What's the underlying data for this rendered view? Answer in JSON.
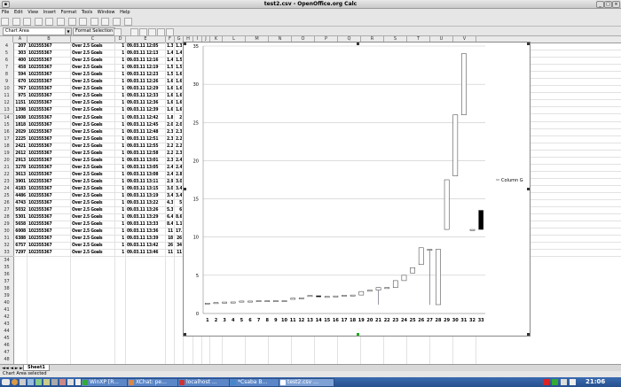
{
  "window": {
    "title": "test2.csv - OpenOffice.org Calc"
  },
  "menu": [
    "File",
    "Edit",
    "View",
    "Insert",
    "Format",
    "Tools",
    "Window",
    "Help"
  ],
  "formatbar": {
    "name_box": "Chart Area",
    "selection_label": "Format Selection"
  },
  "columns": [
    "A",
    "B",
    "C",
    "D",
    "E",
    "F",
    "G",
    "H",
    "I",
    "J",
    "K",
    "L",
    "M",
    "N",
    "O",
    "P",
    "Q",
    "R",
    "S",
    "T",
    "U",
    "V"
  ],
  "rows": [
    [
      "207",
      "102355367",
      "Over 2.5 Goals",
      "1",
      "09.03.11 12:05",
      "1.34",
      "1.36",
      "1.34"
    ],
    [
      "303",
      "102355367",
      "Over 2.5 Goals",
      "1",
      "09.03.11 12:13",
      "1.43",
      "1.43",
      "1.43"
    ],
    [
      "400",
      "102355367",
      "Over 2.5 Goals",
      "1",
      "09.03.11 12:16",
      "1.43",
      "1.5",
      "1.43"
    ],
    [
      "458",
      "102355367",
      "Over 2.5 Goals",
      "1",
      "09.03.11 12:19",
      "1.5",
      "1.5",
      "1.51"
    ],
    [
      "594",
      "102355367",
      "Over 2.5 Goals",
      "1",
      "09.03.11 12:23",
      "1.51",
      "1.63",
      "1.51"
    ],
    [
      "670",
      "102355367",
      "Over 2.5 Goals",
      "1",
      "09.03.11 12:26",
      "1.63",
      "1.63",
      "1.63"
    ],
    [
      "767",
      "102355367",
      "Over 2.5 Goals",
      "1",
      "09.03.11 12:29",
      "1.63",
      "1.68",
      "1.63"
    ],
    [
      "975",
      "102355367",
      "Over 2.5 Goals",
      "1",
      "09.03.11 12:33",
      "1.68",
      "1.68",
      "1.68"
    ],
    [
      "1151",
      "102355367",
      "Over 2.5 Goals",
      "1",
      "09.03.11 12:36",
      "1.68",
      "1.68",
      "1.68"
    ],
    [
      "1398",
      "102355367",
      "Over 2.5 Goals",
      "1",
      "09.03.11 12:39",
      "1.68",
      "1.68",
      "1.68"
    ],
    [
      "1608",
      "102355367",
      "Over 2.5 Goals",
      "1",
      "09.03.11 12:42",
      "1.85",
      "2",
      "1.85"
    ],
    [
      "1818",
      "102355367",
      "Over 2.5 Goals",
      "1",
      "09.03.11 12:45",
      "2.02",
      "2.06",
      "2.02"
    ],
    [
      "2029",
      "102355367",
      "Over 2.5 Goals",
      "1",
      "09.03.11 12:48",
      "2.36",
      "2.36",
      "2.36"
    ],
    [
      "2225",
      "102355367",
      "Over 2.5 Goals",
      "1",
      "09.03.11 12:51",
      "2.32",
      "2.24",
      "2.32"
    ],
    [
      "2421",
      "102355367",
      "Over 2.5 Goals",
      "1",
      "09.03.11 12:55",
      "2.24",
      "2.24",
      "2.24"
    ],
    [
      "2612",
      "102355367",
      "Over 2.5 Goals",
      "1",
      "09.03.11 12:58",
      "2.24",
      "2.3",
      "2.24"
    ],
    [
      "2913",
      "102355367",
      "Over 2.5 Goals",
      "1",
      "09.03.11 13:01",
      "2.3",
      "2.4",
      "2.3"
    ],
    [
      "3278",
      "102355367",
      "Over 2.5 Goals",
      "1",
      "09.03.11 13:05",
      "2.4",
      "2.42",
      "2.4"
    ],
    [
      "3613",
      "102355367",
      "Over 2.5 Goals",
      "1",
      "09.03.11 13:08",
      "2.42",
      "2.88",
      "2.42"
    ],
    [
      "3901",
      "102355367",
      "Over 2.5 Goals",
      "1",
      "09.03.11 13:11",
      "2.92",
      "3.05",
      "1.16"
    ],
    [
      "4183",
      "102355367",
      "Over 2.5 Goals",
      "1",
      "09.03.11 13:15",
      "3.05",
      "3.4",
      "3.05"
    ],
    [
      "4486",
      "102355367",
      "Over 2.5 Goals",
      "1",
      "09.03.11 13:19",
      "3.4",
      "3.4",
      "4.3"
    ],
    [
      "4743",
      "102355367",
      "Over 2.5 Goals",
      "1",
      "09.03.11 13:22",
      "4.3",
      "5",
      "4.3"
    ],
    [
      "5032",
      "102355367",
      "Over 2.5 Goals",
      "1",
      "09.03.11 13:26",
      "5.3",
      "6",
      "5.3"
    ],
    [
      "5301",
      "102355367",
      "Over 2.5 Goals",
      "1",
      "09.03.11 13:29",
      "6.4",
      "8.6",
      "6.4"
    ],
    [
      "5658",
      "102355367",
      "Over 2.5 Goals",
      "1",
      "09.03.11 13:33",
      "8.4",
      "1.13",
      "1.13"
    ],
    [
      "6008",
      "102355367",
      "Over 2.5 Goals",
      "1",
      "09.03.11 13:36",
      "11",
      "17.5",
      "11"
    ],
    [
      "6388",
      "102355367",
      "Over 2.5 Goals",
      "1",
      "09.03.11 13:39",
      "18",
      "26",
      "18"
    ],
    [
      "6757",
      "102355367",
      "Over 2.5 Goals",
      "1",
      "09.03.11 13:42",
      "26",
      "34",
      "26"
    ],
    [
      "7297",
      "102355367",
      "Over 2.5 Goals",
      "1",
      "09.03.11 13:46",
      "11",
      "11",
      "13.5"
    ]
  ],
  "first_row": 4,
  "last_row": 53,
  "chart_data": {
    "type": "candlestick",
    "categories": [
      "1",
      "2",
      "3",
      "4",
      "5",
      "6",
      "7",
      "8",
      "9",
      "10",
      "11",
      "12",
      "13",
      "14",
      "15",
      "16",
      "17",
      "18",
      "19",
      "20",
      "21",
      "22",
      "23",
      "24",
      "25",
      "26",
      "27",
      "28",
      "29",
      "30",
      "31",
      "32",
      "33"
    ],
    "open": [
      1.34,
      1.43,
      1.43,
      1.5,
      1.51,
      1.63,
      1.63,
      1.68,
      1.68,
      1.68,
      1.85,
      2.02,
      2.36,
      2.32,
      2.24,
      2.24,
      2.3,
      2.4,
      2.42,
      2.92,
      3.05,
      3.4,
      3.4,
      4.3,
      5.3,
      6.4,
      8.4,
      1.16,
      11,
      18,
      26,
      11,
      13.5
    ],
    "close": [
      1.36,
      1.43,
      1.5,
      1.51,
      1.63,
      1.63,
      1.68,
      1.68,
      1.68,
      1.68,
      2.0,
      2.06,
      2.36,
      2.24,
      2.24,
      2.3,
      2.4,
      2.42,
      2.88,
      3.05,
      3.4,
      3.4,
      4.3,
      5.0,
      6.0,
      8.6,
      8.4,
      8.4,
      17.5,
      26,
      34,
      11,
      11
    ],
    "high": [
      1.36,
      1.43,
      1.5,
      1.51,
      1.63,
      1.63,
      1.68,
      1.68,
      1.68,
      1.68,
      2.0,
      2.06,
      2.36,
      2.32,
      2.24,
      2.3,
      2.4,
      2.42,
      2.88,
      3.05,
      3.4,
      3.4,
      4.3,
      5.0,
      6.0,
      8.6,
      8.4,
      8.4,
      17.5,
      26,
      34,
      11,
      13.5
    ],
    "low": [
      1.34,
      1.43,
      1.43,
      1.5,
      1.51,
      1.63,
      1.63,
      1.68,
      1.68,
      1.68,
      1.85,
      2.02,
      2.36,
      2.24,
      2.24,
      2.24,
      2.3,
      2.4,
      2.42,
      2.92,
      1.16,
      3.4,
      3.4,
      4.3,
      5.3,
      6.4,
      1.13,
      1.16,
      11,
      18,
      26,
      11,
      11
    ],
    "ylim": [
      0,
      35
    ],
    "yticks": [
      "0",
      "5",
      "10",
      "15",
      "20",
      "25",
      "30",
      "35"
    ],
    "legend": "Column G",
    "legend_position": "right",
    "grid": true
  },
  "sheet_tab": "Sheet1",
  "status": "Chart Area selected",
  "taskbar": [
    "WinXP [R...",
    "XChat: pe...",
    "localhost ...",
    "*Csaba B...",
    "test2.csv ..."
  ],
  "clock": "21:06",
  "colors": {
    "taskbar": "#2f5d9e",
    "accent_dark": "#000000"
  }
}
